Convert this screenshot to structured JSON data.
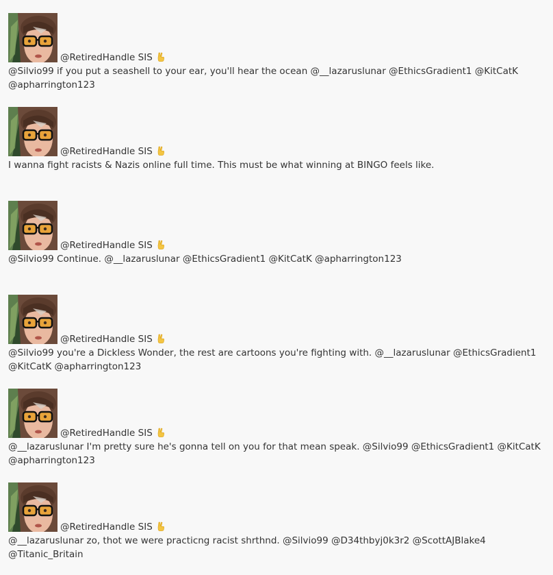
{
  "colors": {
    "background": "#f8f8f8",
    "text": "#333333",
    "emoji": "#f4c542"
  },
  "icons": {
    "avatar": "profile-photo-woman-orange-glasses",
    "handle_emoji": "victory-hand-icon"
  },
  "tweets": [
    {
      "handle": "@RetiredHandle SIS",
      "text": "@Silvio99 if you put a seashell to your ear, you'll hear the ocean @__lazaruslunar @EthicsGradient1 @KitCatK @apharrington123"
    },
    {
      "handle": "@RetiredHandle SIS",
      "text": "I wanna fight racists & Nazis online full time. This must be what winning at BINGO feels like."
    },
    {
      "handle": "@RetiredHandle SIS",
      "text": "@Silvio99 Continue. @__lazaruslunar @EthicsGradient1 @KitCatK @apharrington123"
    },
    {
      "handle": "@RetiredHandle SIS",
      "text": "@Silvio99 you're a Dickless Wonder, the rest are cartoons you're fighting with. @__lazaruslunar @EthicsGradient1 @KitCatK @apharrington123"
    },
    {
      "handle": "@RetiredHandle SIS",
      "text": "@__lazaruslunar I'm pretty sure he's gonna tell on you for that mean speak. @Silvio99 @EthicsGradient1 @KitCatK @apharrington123"
    },
    {
      "handle": "@RetiredHandle SIS",
      "text": "@__lazaruslunar zo, thot we were practicng racist shrthnd. @Silvio99 @D34thbyj0k3r2 @ScottAJBlake4 @Titanic_Britain"
    }
  ]
}
